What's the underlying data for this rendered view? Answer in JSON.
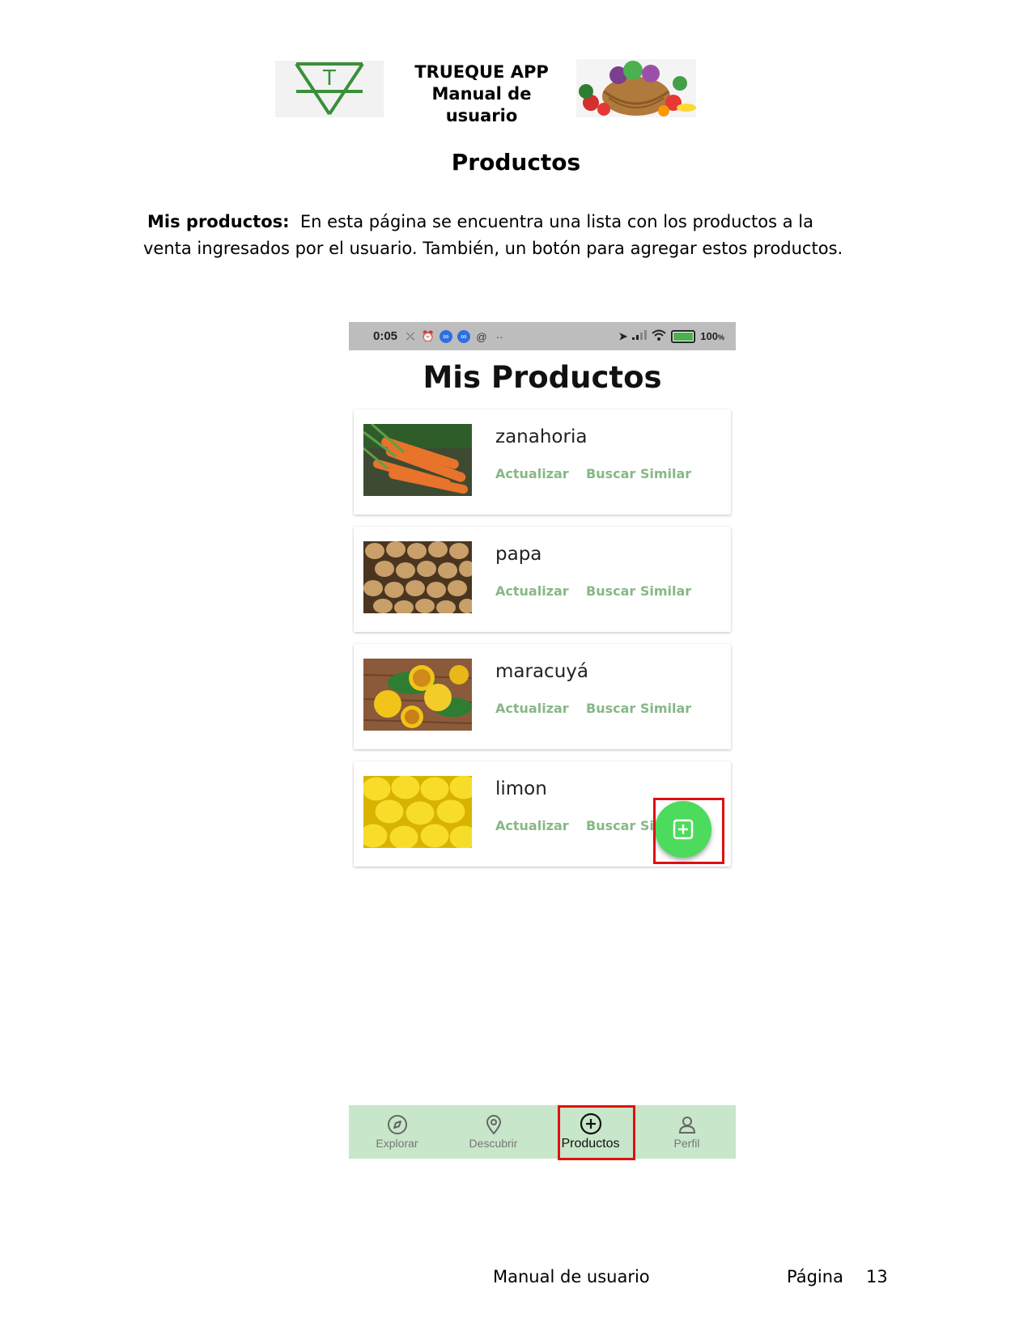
{
  "header": {
    "title_line1": "TRUEQUE APP",
    "title_line2": "Manual de usuario",
    "logo_letter": "T"
  },
  "section_title": "Productos",
  "intro": {
    "bold": "Mis productos:",
    "text": "En esta página se encuentra una lista con los productos a la venta ingresados por el usuario. También, un botón para agregar estos productos."
  },
  "phone": {
    "status_bar": {
      "time": "0:05",
      "battery": "100",
      "battery_unit": "%",
      "battery_level": 1.0
    },
    "screen_title": "Mis Productos",
    "products": [
      {
        "name": "zanahoria",
        "update_label": "Actualizar",
        "similar_label": "Buscar Similar"
      },
      {
        "name": "papa",
        "update_label": "Actualizar",
        "similar_label": "Buscar Similar"
      },
      {
        "name": "maracuyá",
        "update_label": "Actualizar",
        "similar_label": "Buscar Similar"
      },
      {
        "name": "limon",
        "update_label": "Actualizar",
        "similar_label": "Buscar Simi"
      }
    ],
    "fab_icon": "add-box-icon",
    "nav": [
      {
        "label": "Explorar",
        "icon": "compass-icon"
      },
      {
        "label": "Descubrir",
        "icon": "location-pin-icon"
      },
      {
        "label": "Productos",
        "icon": "add-circle-icon",
        "active": true
      },
      {
        "label": "Perfil",
        "icon": "person-icon"
      }
    ],
    "accent_green": "#4cdb5c",
    "action_green": "#86b886",
    "nav_bg": "#c8e6c9",
    "highlight_red": "#e01010"
  },
  "footer": {
    "left": "Manual de usuario",
    "page_label": "Página",
    "page_number": "13"
  }
}
